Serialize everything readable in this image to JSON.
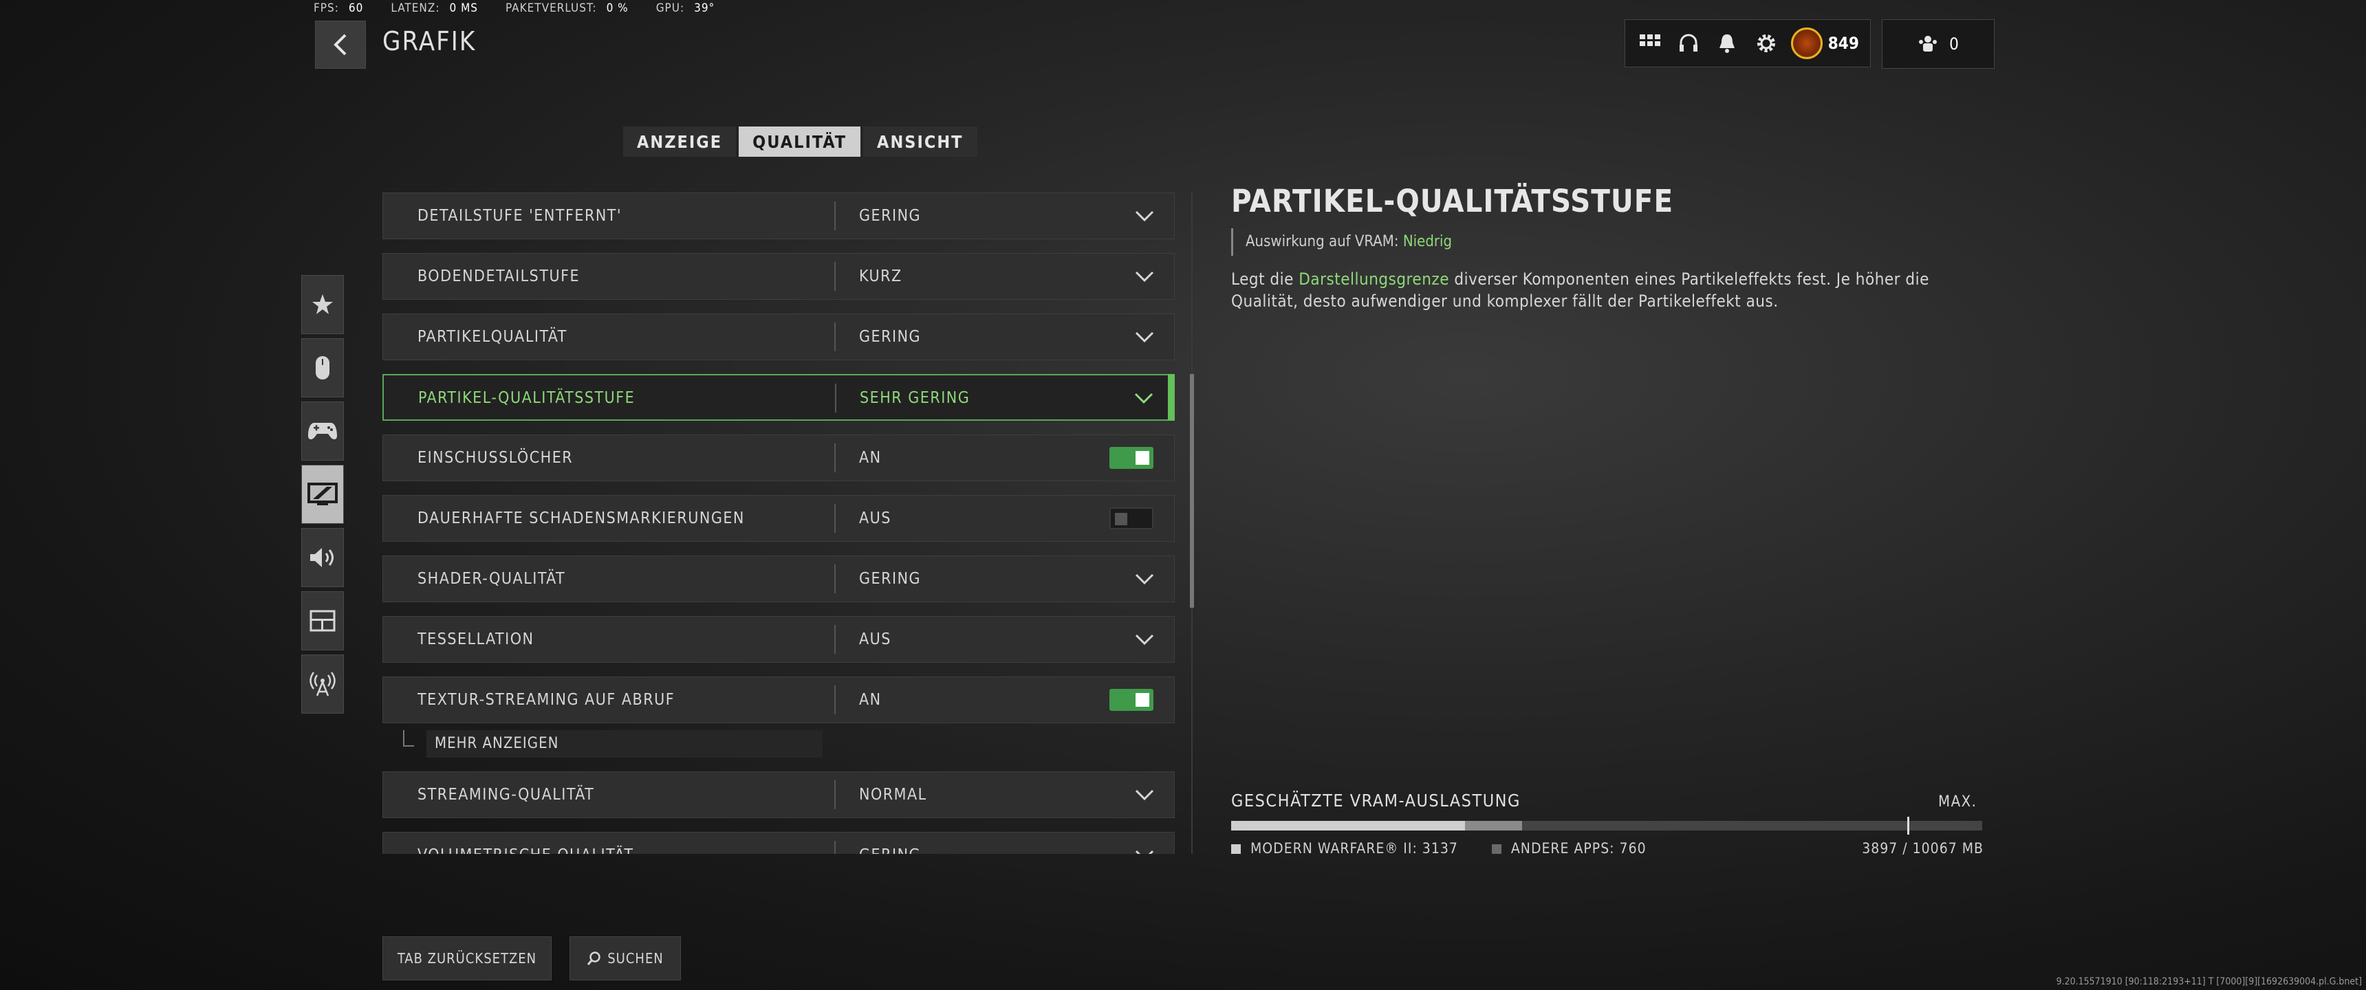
{
  "stats": [
    {
      "label": "FPS:",
      "value": "60"
    },
    {
      "label": "LATENZ:",
      "value": "0 MS"
    },
    {
      "label": "PAKETVERLUST:",
      "value": "0 %"
    },
    {
      "label": "GPU:",
      "value": "39°"
    }
  ],
  "header": {
    "title": "GRAFIK",
    "cod_points": "849",
    "party_count": "0"
  },
  "tabs": [
    {
      "label": "ANZEIGE",
      "active": false
    },
    {
      "label": "QUALITÄT",
      "active": true
    },
    {
      "label": "ANSICHT",
      "active": false
    }
  ],
  "settings": {
    "rows": [
      {
        "label": "DETAILSTUFE 'ENTFERNT'",
        "value": "GERING",
        "control": "dropdown"
      },
      {
        "label": "BODENDETAILSTUFE",
        "value": "KURZ",
        "control": "dropdown"
      },
      {
        "label": "PARTIKELQUALITÄT",
        "value": "GERING",
        "control": "dropdown"
      },
      {
        "label": "PARTIKEL-QUALITÄTSSTUFE",
        "value": "SEHR GERING",
        "control": "dropdown",
        "selected": true
      },
      {
        "label": "EINSCHUSSLÖCHER",
        "value": "AN",
        "control": "toggle",
        "on": true
      },
      {
        "label": "DAUERHAFTE SCHADENSMARKIERUNGEN",
        "value": "AUS",
        "control": "toggle",
        "on": false
      },
      {
        "label": "SHADER-QUALITÄT",
        "value": "GERING",
        "control": "dropdown"
      },
      {
        "label": "TESSELLATION",
        "value": "AUS",
        "control": "dropdown"
      },
      {
        "label": "TEXTUR-STREAMING AUF ABRUF",
        "value": "AN",
        "control": "toggle",
        "on": true
      },
      {
        "label": "STREAMING-QUALITÄT",
        "value": "NORMAL",
        "control": "dropdown"
      },
      {
        "label": "VOLUMETRISCHE QUALITÄT",
        "value": "GERING",
        "control": "dropdown"
      }
    ],
    "more_label": "MEHR ANZEIGEN"
  },
  "detail": {
    "title": "PARTIKEL-QUALITÄTSSTUFE",
    "vram_prefix": "Auswirkung auf VRAM:",
    "vram_level": "Niedrig",
    "desc_pre": "Legt die ",
    "desc_highlight": "Darstellungsgrenze",
    "desc_post": " diverser Komponenten eines Partikeleffekts fest. Je höher die Qualität, desto aufwendiger und komplexer fällt der Partikeleffekt aus."
  },
  "vram": {
    "heading": "GESCHÄTZTE VRAM-AUSLASTUNG",
    "max_label": "MAX.",
    "mw_label": "MODERN WARFARE® II: 3137",
    "other_label": "ANDERE APPS: 760",
    "total": "3897 / 10067 MB",
    "mw_mb": 3137,
    "other_mb": 760,
    "max_mb": 10067,
    "limit_fraction": 0.9,
    "colors": {
      "mw": "#cfcfcf",
      "other": "#8a8a8a"
    }
  },
  "bottom": {
    "reset_label": "TAB ZURÜCKSETZEN",
    "search_label": "SUCHEN"
  },
  "build_info": "9.20.15571910 [90:118:2193+11] T [7000][9][1692639004.pl.G.bnet]",
  "colors": {
    "accent": "#63c05a",
    "selected_text": "#8ed87a"
  }
}
